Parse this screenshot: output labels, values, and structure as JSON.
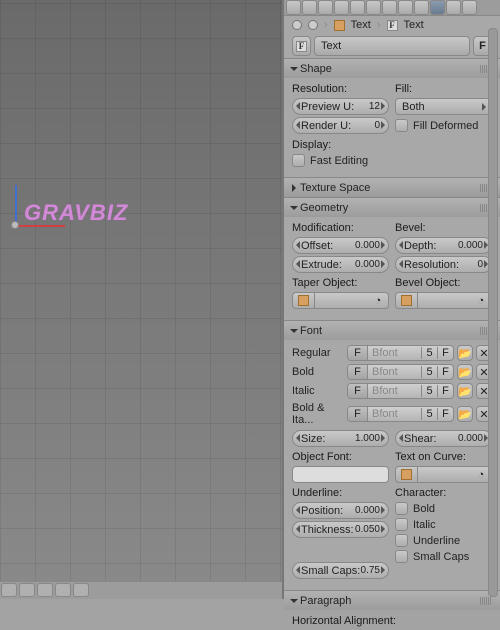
{
  "viewport_text": "GRAVBIZ",
  "datablock": {
    "name": "Text",
    "fake_label": "F",
    "icon_letter": "F"
  },
  "crumbs": {
    "obj": "Text",
    "data": "Text"
  },
  "sections": {
    "shape": {
      "title": "Shape",
      "resolution_label": "Resolution:",
      "preview_u": "Preview U:",
      "preview_u_val": "12",
      "render_u": "Render U:",
      "render_u_val": "0",
      "fill_label": "Fill:",
      "fill_mode": "Both",
      "fill_deformed": "Fill Deformed",
      "display_label": "Display:",
      "fast_editing": "Fast Editing"
    },
    "texture_space": {
      "title": "Texture Space"
    },
    "geometry": {
      "title": "Geometry",
      "modification_label": "Modification:",
      "offset": "Offset:",
      "offset_val": "0.000",
      "extrude": "Extrude:",
      "extrude_val": "0.000",
      "bevel_label": "Bevel:",
      "depth": "Depth:",
      "depth_val": "0.000",
      "resolution": "Resolution:",
      "resolution_val": "0",
      "taper_label": "Taper Object:",
      "bevelobj_label": "Bevel Object:"
    },
    "font": {
      "title": "Font",
      "regular": "Regular",
      "bold": "Bold",
      "italic": "Italic",
      "bold_italic": "Bold & Ita...",
      "font_name": "Bfont",
      "font_users": "5",
      "F": "F",
      "size": "Size:",
      "size_val": "1.000",
      "shear": "Shear:",
      "shear_val": "0.000",
      "object_font": "Object Font:",
      "text_on_curve": "Text on Curve:",
      "underline_label": "Underline:",
      "position": "Position:",
      "position_val": "0.000",
      "thickness": "Thickness:",
      "thickness_val": "0.050",
      "character_label": "Character:",
      "c_bold": "Bold",
      "c_italic": "Italic",
      "c_underline": "Underline",
      "c_smallcaps": "Small Caps",
      "small_caps": "Small Caps:",
      "small_caps_val": "0.75"
    },
    "paragraph": {
      "title": "Paragraph",
      "halign": "Horizontal Alignment:"
    }
  }
}
